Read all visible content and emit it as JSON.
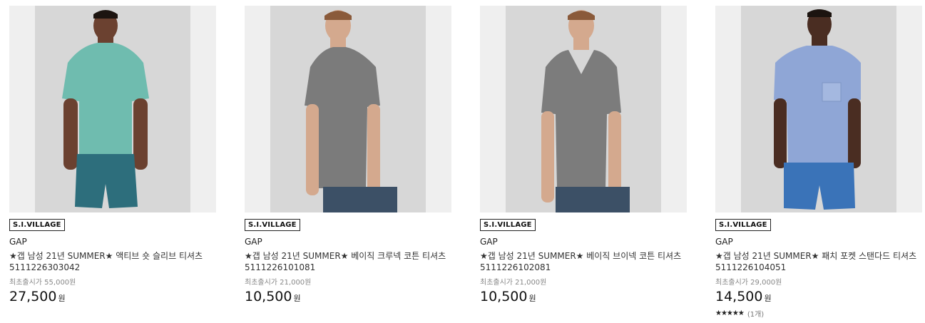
{
  "products": [
    {
      "badge": "S.I.VILLAGE",
      "brand": "GAP",
      "title": "★갭 남성 21년 SUMMER★ 액티브 숏 슬리브 티셔츠 5111226303042",
      "original_price_text": "최초출시가 55,000원",
      "price": "27,500",
      "currency": "원",
      "shirt_color": "#6fbcaf",
      "shorts_color": "#2d6e7c",
      "skin_color": "#6b4130"
    },
    {
      "badge": "S.I.VILLAGE",
      "brand": "GAP",
      "title": "★갭 남성 21년 SUMMER★ 베이직 크루넥 코튼 티셔츠 5111226101081",
      "original_price_text": "최초출시가 21,000원",
      "price": "10,500",
      "currency": "원",
      "shirt_color": "#7b7b7b",
      "shorts_color": "#3c5066",
      "skin_color": "#d4a98e"
    },
    {
      "badge": "S.I.VILLAGE",
      "brand": "GAP",
      "title": "★갭 남성 21년 SUMMER★ 베이직 브이넥 코튼 티셔츠 5111226102081",
      "original_price_text": "최초출시가 21,000원",
      "price": "10,500",
      "currency": "원",
      "shirt_color": "#7c7c7c",
      "shorts_color": "#3c5066",
      "skin_color": "#d4a98e"
    },
    {
      "badge": "S.I.VILLAGE",
      "brand": "GAP",
      "title": "★갭 남성 21년 SUMMER★ 패치 포켓 스탠다드 티셔츠 5111226104051",
      "original_price_text": "최초출시가 29,000원",
      "price": "14,500",
      "currency": "원",
      "stars": "★★★★★",
      "review_count": "(1개)",
      "shirt_color": "#8fa6d6",
      "shorts_color": "#3a73b8",
      "skin_color": "#4a2d22"
    }
  ]
}
